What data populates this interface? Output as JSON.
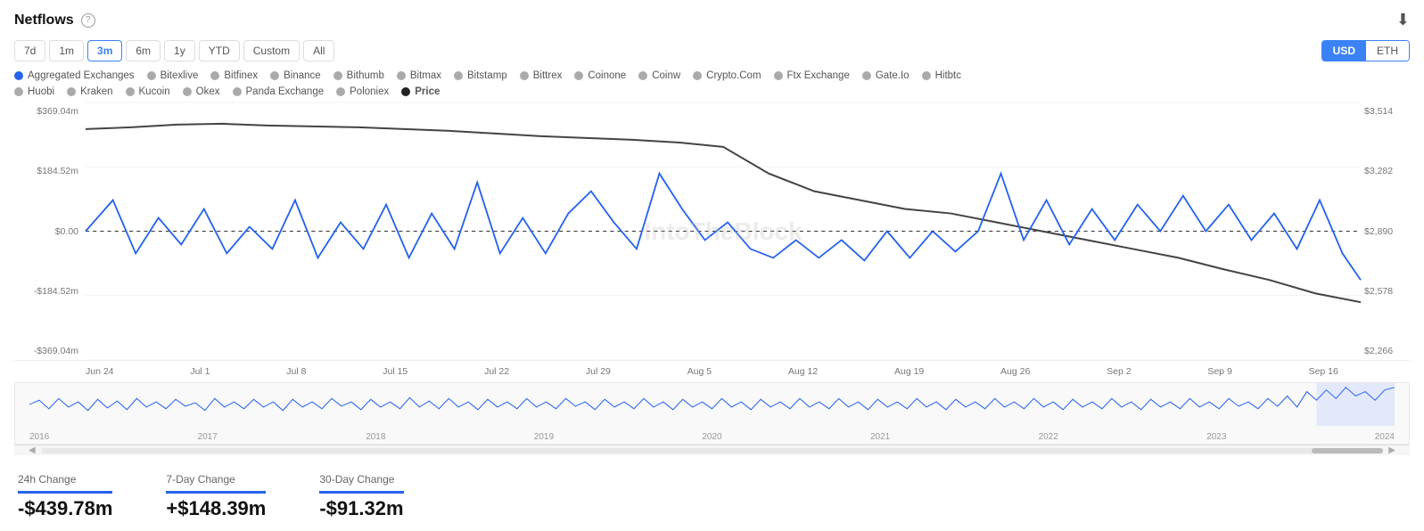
{
  "header": {
    "title": "Netflows",
    "help_label": "?",
    "download_icon": "⬇"
  },
  "time_filters": [
    {
      "label": "7d",
      "active": false
    },
    {
      "label": "1m",
      "active": false
    },
    {
      "label": "3m",
      "active": true
    },
    {
      "label": "6m",
      "active": false
    },
    {
      "label": "1y",
      "active": false
    },
    {
      "label": "YTD",
      "active": false
    },
    {
      "label": "Custom",
      "active": false
    },
    {
      "label": "All",
      "active": false
    }
  ],
  "currency_options": [
    {
      "label": "USD",
      "active": true
    },
    {
      "label": "ETH",
      "active": false
    }
  ],
  "legend": [
    {
      "label": "Aggregated Exchanges",
      "color": "blue",
      "type": "dot"
    },
    {
      "label": "Bitexlive",
      "color": "gray-light",
      "type": "dot"
    },
    {
      "label": "Bitfinex",
      "color": "gray-light",
      "type": "dot"
    },
    {
      "label": "Binance",
      "color": "gray-light",
      "type": "dot"
    },
    {
      "label": "Bithumb",
      "color": "gray-light",
      "type": "dot"
    },
    {
      "label": "Bitmax",
      "color": "gray-light",
      "type": "dot"
    },
    {
      "label": "Bitstamp",
      "color": "gray-light",
      "type": "dot"
    },
    {
      "label": "Bittrex",
      "color": "gray-light",
      "type": "dot"
    },
    {
      "label": "Coinone",
      "color": "gray-light",
      "type": "dot"
    },
    {
      "label": "Coinw",
      "color": "gray-light",
      "type": "dot"
    },
    {
      "label": "Crypto.Com",
      "color": "gray-light",
      "type": "dot"
    },
    {
      "label": "Ftx Exchange",
      "color": "gray-light",
      "type": "dot"
    },
    {
      "label": "Gate.Io",
      "color": "gray-light",
      "type": "dot"
    },
    {
      "label": "Hitbtc",
      "color": "gray-light",
      "type": "dot"
    },
    {
      "label": "Huobi",
      "color": "gray-light",
      "type": "dot"
    },
    {
      "label": "Kraken",
      "color": "gray-light",
      "type": "dot"
    },
    {
      "label": "Kucoin",
      "color": "gray-light",
      "type": "dot"
    },
    {
      "label": "Okex",
      "color": "gray-light",
      "type": "dot"
    },
    {
      "label": "Panda Exchange",
      "color": "gray-light",
      "type": "dot"
    },
    {
      "label": "Poloniex",
      "color": "gray-light",
      "type": "dot"
    },
    {
      "label": "Price",
      "color": "dark",
      "type": "dot"
    }
  ],
  "y_axis_left": [
    "$369.04m",
    "$184.52m",
    "$0.00",
    "-$184.52m",
    "-$369.04m"
  ],
  "y_axis_right": [
    "$3,514",
    "$3,282",
    "$2,890",
    "$2,578",
    "$2,266"
  ],
  "x_axis_labels": [
    "Jun 24",
    "Jul 1",
    "Jul 8",
    "Jul 15",
    "Jul 22",
    "Jul 29",
    "Aug 5",
    "Aug 12",
    "Aug 19",
    "Aug 26",
    "Sep 2",
    "Sep 9",
    "Sep 16"
  ],
  "mini_x_axis": [
    "2016",
    "2017",
    "2018",
    "2019",
    "2020",
    "2021",
    "2022",
    "2023",
    "2024"
  ],
  "watermark": "IntoTheBlock",
  "stats": [
    {
      "label": "24h Change",
      "value": "-$439.78m"
    },
    {
      "label": "7-Day Change",
      "value": "+$148.39m"
    },
    {
      "label": "30-Day Change",
      "value": "-$91.32m"
    }
  ]
}
